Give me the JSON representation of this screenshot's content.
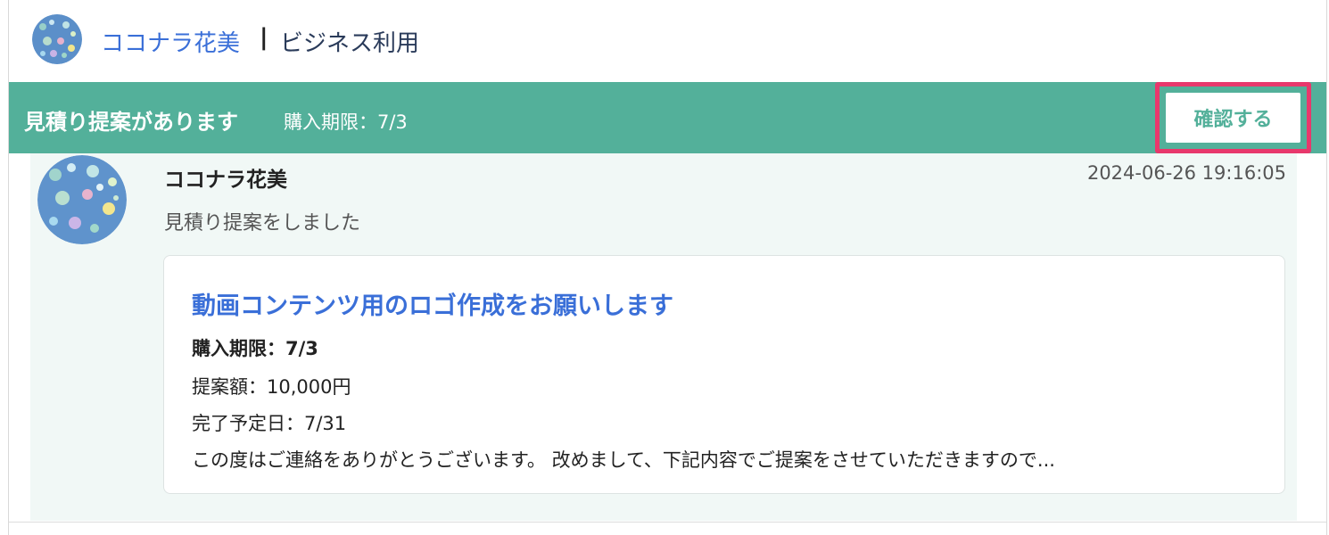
{
  "header": {
    "shop_name": "ココナラ花美",
    "separator": "|",
    "subtitle": "ビジネス利用"
  },
  "banner": {
    "title": "見積り提案があります",
    "deadline": "購入期限：7/3",
    "confirm_label": "確認する",
    "color": "#53b09a",
    "highlight_color": "#e8386c"
  },
  "message": {
    "sender": "ココナラ花美",
    "timestamp": "2024-06-26 19:16:05",
    "text": "見積り提案をしました"
  },
  "proposal": {
    "title": "動画コンテンツ用のロゴ作成をお願いします",
    "deadline": "購入期限：7/3",
    "amount": "提案額：10,000円",
    "completion": "完了予定日：7/31",
    "body": "この度はご連絡をありがとうございます。 改めまして、下記内容でご提案をさせていただきますので..."
  },
  "icons": {
    "header_avatar": "avatar-balloons-icon",
    "message_avatar": "avatar-balloons-icon"
  }
}
